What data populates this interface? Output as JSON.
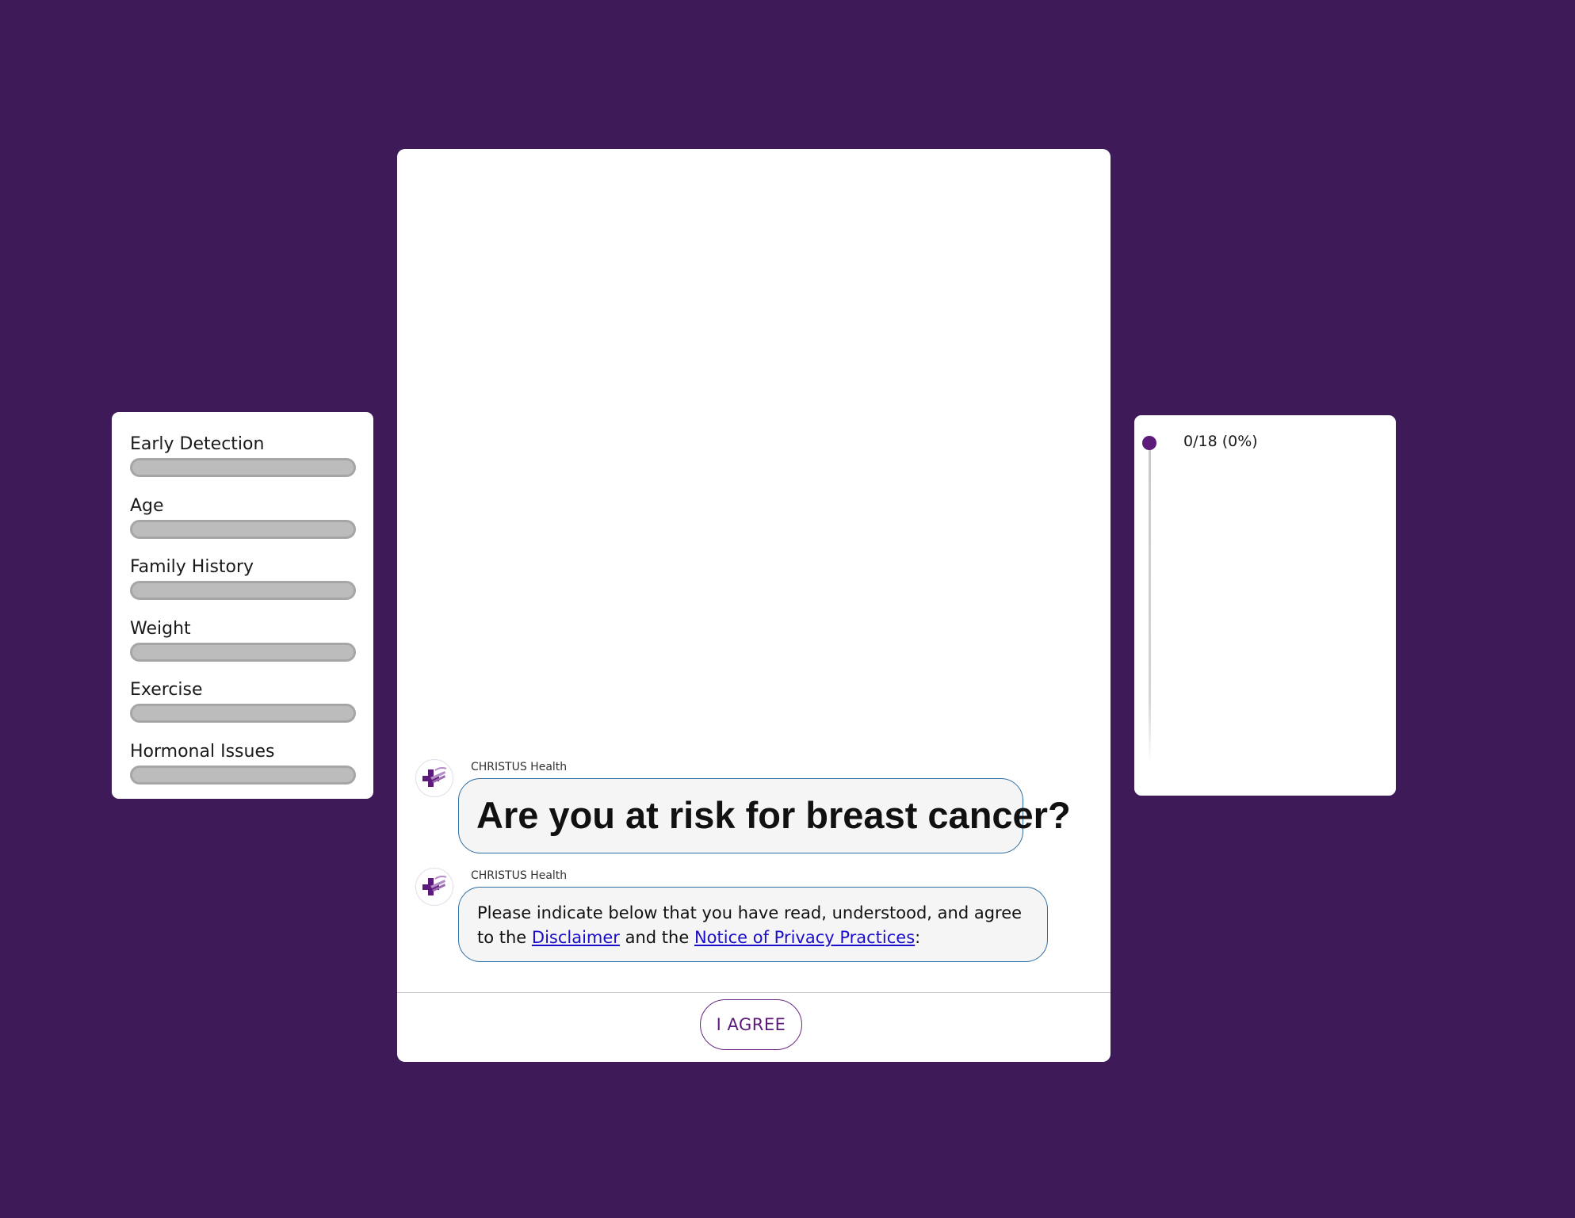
{
  "categories": {
    "items": [
      {
        "label": "Early Detection",
        "progress": 0
      },
      {
        "label": "Age",
        "progress": 0
      },
      {
        "label": "Family History",
        "progress": 0
      },
      {
        "label": "Weight",
        "progress": 0
      },
      {
        "label": "Exercise",
        "progress": 0
      },
      {
        "label": "Hormonal Issues",
        "progress": 0
      }
    ]
  },
  "chat": {
    "messages": [
      {
        "sender": "CHRISTUS Health",
        "heading": "Are you at risk for breast cancer?"
      },
      {
        "sender": "CHRISTUS Health",
        "text_before": "Please  indicate below that you have read, understood, and agree to the ",
        "link1": "Disclaimer",
        "text_middle": " and the ",
        "link2": "Notice of Privacy Practices",
        "text_after": ":"
      }
    ],
    "agree_label": "I AGREE"
  },
  "progress": {
    "answered": 0,
    "total": 18,
    "label": "0/18 (0%)"
  },
  "colors": {
    "background": "#3e1a59",
    "accent": "#5c1a7a",
    "bubble_border": "#2f6fa3",
    "link": "#1a0dcc"
  },
  "icons": {
    "avatar": "christus-cross-logo-icon",
    "progress_marker": "progress-dot-icon"
  }
}
